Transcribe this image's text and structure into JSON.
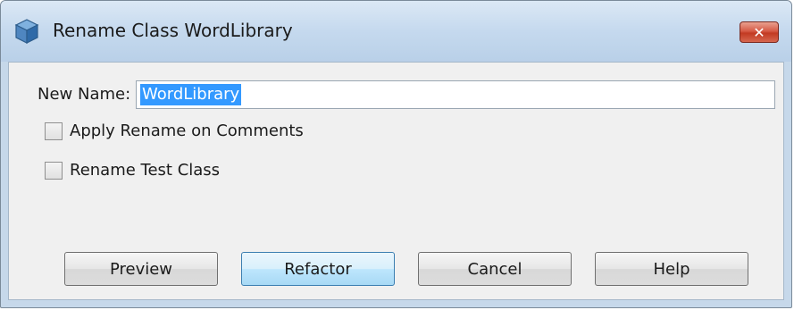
{
  "window": {
    "title": "Rename Class WordLibrary",
    "close_glyph": "✕"
  },
  "form": {
    "new_name_label": "New Name:",
    "new_name_value": "WordLibrary",
    "apply_rename_comments_label": "Apply Rename on Comments",
    "apply_rename_comments_checked": false,
    "rename_test_class_label": "Rename Test Class",
    "rename_test_class_checked": false
  },
  "buttons": {
    "preview": "Preview",
    "refactor": "Refactor",
    "cancel": "Cancel",
    "help": "Help"
  },
  "icons": {
    "app": "netbeans-cube-icon",
    "close": "close-icon"
  },
  "colors": {
    "selection": "#3399ff",
    "close_button": "#c23a22",
    "titlebar": "#c5d9ee"
  }
}
